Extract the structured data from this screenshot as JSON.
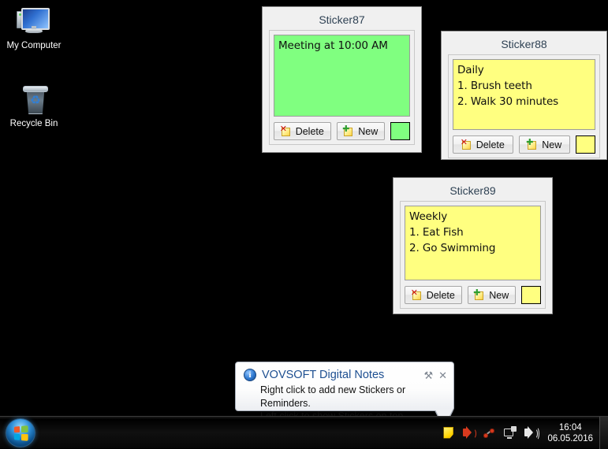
{
  "desktop": {
    "background_color": "#000000",
    "icons": [
      {
        "name": "my-computer",
        "label": "My Computer",
        "icon": "computer-icon"
      },
      {
        "name": "recycle-bin",
        "label": "Recycle Bin",
        "icon": "recycle-bin-icon"
      }
    ]
  },
  "stickers": [
    {
      "title": "Sticker87",
      "text": "Meeting at 10:00 AM",
      "color": "#80FF80",
      "delete_label": "Delete",
      "new_label": "New",
      "color_label": ""
    },
    {
      "title": "Sticker88",
      "text": "Daily\n1. Brush teeth\n2. Walk 30 minutes",
      "color": "#FFFF80",
      "delete_label": "Delete",
      "new_label": "New",
      "color_label": ""
    },
    {
      "title": "Sticker89",
      "text": "Weekly\n1. Eat Fish\n2. Go Swimming",
      "color": "#FFFF80",
      "delete_label": "Delete",
      "new_label": "New",
      "color_label": ""
    }
  ],
  "balloon": {
    "title": "VOVSOFT Digital Notes",
    "line1": "Right click to add new Stickers or Reminders.",
    "line2": "Left click to show Stickers on top.",
    "info_glyph": "i",
    "options_glyph": "⚒",
    "close_glyph": "✕",
    "title_color": "#1D4F91"
  },
  "taskbar": {
    "start_label": "Start",
    "tray": [
      {
        "name": "digital-notes-tray-icon",
        "title": "VOVSOFT Digital Notes"
      },
      {
        "name": "volume-muted-tray-icon",
        "title": "Volume"
      },
      {
        "name": "network-problem-tray-icon",
        "title": "Network"
      },
      {
        "name": "network-tray-icon",
        "title": "Network Connections"
      },
      {
        "name": "speakers-tray-icon",
        "title": "Speakers"
      }
    ],
    "clock": {
      "time": "16:04",
      "date": "06.05.2016"
    }
  }
}
